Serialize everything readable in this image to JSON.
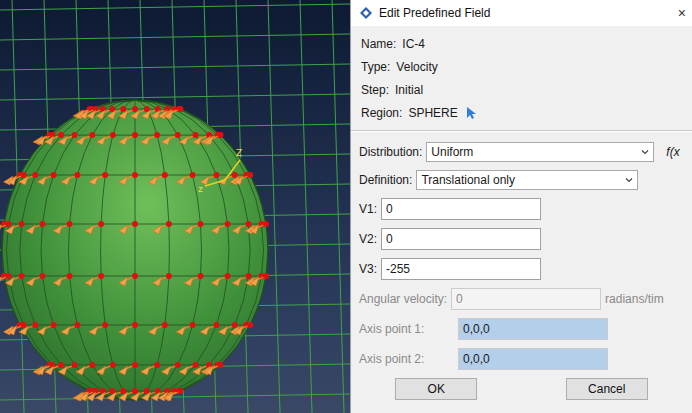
{
  "viewport": {
    "triad_labels": [
      "Z",
      "z"
    ]
  },
  "dialog": {
    "title": "Edit Predefined Field",
    "close": "×",
    "info": [
      {
        "label": "Name:",
        "value": "IC-4"
      },
      {
        "label": "Type:",
        "value": "Velocity"
      },
      {
        "label": "Step:",
        "value": "Initial"
      },
      {
        "label": "Region:",
        "value": "SPHERE"
      }
    ],
    "distribution": {
      "label": "Distribution:",
      "value": "Uniform",
      "extra": "f(x"
    },
    "definition": {
      "label": "Definition:",
      "value": "Translational only"
    },
    "velocities": [
      {
        "label": "V1:",
        "value": "0"
      },
      {
        "label": "V2:",
        "value": "0"
      },
      {
        "label": "V3:",
        "value": "-255"
      }
    ],
    "angular": {
      "label": "Angular velocity:",
      "value": "0",
      "unit": "radians/tim",
      "disabled": true
    },
    "axis_points": [
      {
        "label": "Axis point 1:",
        "value": "0,0,0",
        "disabled": true
      },
      {
        "label": "Axis point 2:",
        "value": "0,0,0",
        "disabled": true
      }
    ],
    "buttons": [
      "OK",
      "Cancel"
    ]
  }
}
